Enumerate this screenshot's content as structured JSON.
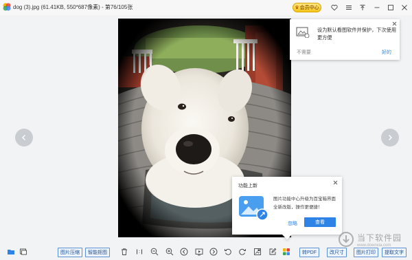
{
  "window": {
    "title": "dog (3).jpg (61.41KB, 550*687像素) - 第76/105张",
    "vip_label": "会员中心",
    "colors": {
      "accent": "#2e83e6",
      "vip": "#f5c518"
    }
  },
  "image": {
    "description_icon": "photo-dog"
  },
  "popup_default": {
    "message": "设为默认看图软件并保护，下次使用更方便",
    "dismiss_label": "不需要",
    "confirm_label": "好的"
  },
  "popup_feature": {
    "heading": "功能上新",
    "message": "图片功能中心升级为百宝箱界面全新改版，操作更便捷！",
    "ignore_label": "忽略",
    "view_label": "查看"
  },
  "toolbar": {
    "compress_label": "图片压缩",
    "cutout_label": "智能抠图",
    "to_pdf_label": "转PDF",
    "resize_label": "改尺寸",
    "print_label": "图片打印",
    "ocr_label": "提取文字"
  },
  "watermark": {
    "name": "当下软件园",
    "url": "www.downxia.com"
  }
}
